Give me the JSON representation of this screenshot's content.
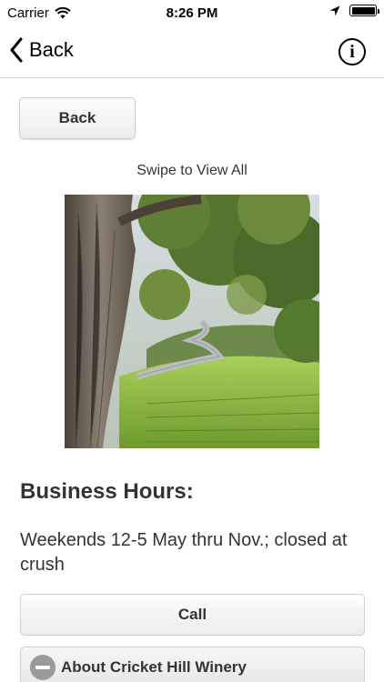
{
  "status_bar": {
    "carrier": "Carrier",
    "time": "8:26 PM",
    "battery_level": 1.0
  },
  "nav": {
    "back_label": "Back",
    "info_label": "i"
  },
  "content": {
    "back_button_label": "Back",
    "swipe_hint": "Swipe to View All",
    "hours_title": "Business Hours:",
    "hours_text": "Weekends 12-5 May thru Nov.; closed at crush",
    "call_button_label": "Call",
    "about_label": "About Cricket Hill Winery"
  },
  "colors": {
    "text_dark": "#333333",
    "button_border": "#cfcfcf",
    "about_icon": "#9a9a9a"
  }
}
